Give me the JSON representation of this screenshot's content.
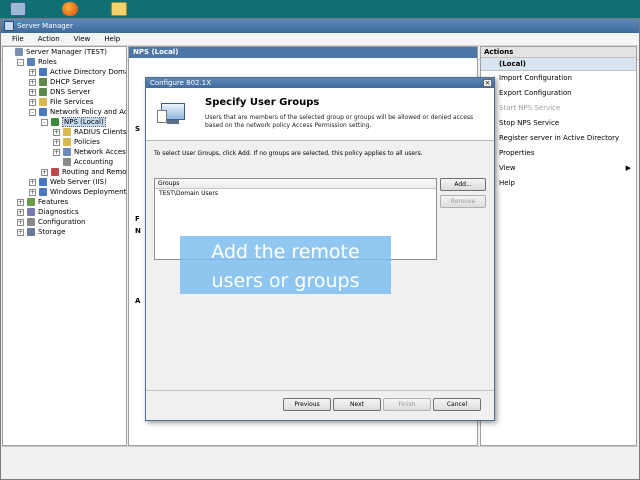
{
  "window": {
    "title": "Server Manager"
  },
  "menu": [
    "File",
    "Action",
    "View",
    "Help"
  ],
  "tree": [
    {
      "label": "Server Manager (TEST)",
      "level": 0,
      "expander": "",
      "icon": "server-icon",
      "color": "#7a8fb0"
    },
    {
      "label": "Roles",
      "level": 1,
      "expander": "-",
      "icon": "roles-icon",
      "color": "#5a7fb5"
    },
    {
      "label": "Active Directory Domain Se",
      "level": 2,
      "expander": "+",
      "icon": "directory-icon",
      "color": "#4a78c0"
    },
    {
      "label": "DHCP Server",
      "level": 2,
      "expander": "+",
      "icon": "dhcp-icon",
      "color": "#5c8a4a"
    },
    {
      "label": "DNS Server",
      "level": 2,
      "expander": "+",
      "icon": "dns-icon",
      "color": "#5c8a4a"
    },
    {
      "label": "File Services",
      "level": 2,
      "expander": "+",
      "icon": "folder-icon",
      "color": "#d8b84a"
    },
    {
      "label": "Network Policy and Access",
      "level": 2,
      "expander": "-",
      "icon": "network-icon",
      "color": "#4a78c0"
    },
    {
      "label": "NPS (Local)",
      "level": 3,
      "expander": "-",
      "icon": "nps-icon",
      "color": "#3d8a3d",
      "selected": true
    },
    {
      "label": "RADIUS Clients and",
      "level": 4,
      "expander": "+",
      "icon": "folder-icon",
      "color": "#d8b84a"
    },
    {
      "label": "Policies",
      "level": 4,
      "expander": "+",
      "icon": "folder-icon",
      "color": "#d8b84a"
    },
    {
      "label": "Network Access Pro",
      "level": 4,
      "expander": "+",
      "icon": "shield-icon",
      "color": "#6a8ac0"
    },
    {
      "label": "Accounting",
      "level": 4,
      "expander": "",
      "icon": "accounting-icon",
      "color": "#8a8a8a"
    },
    {
      "label": "Routing and Remote Ac",
      "level": 3,
      "expander": "+",
      "icon": "routing-icon",
      "color": "#c04a4a"
    },
    {
      "label": "Web Server (IIS)",
      "level": 2,
      "expander": "+",
      "icon": "web-icon",
      "color": "#4a78c0"
    },
    {
      "label": "Windows Deployment Servi",
      "level": 2,
      "expander": "+",
      "icon": "deploy-icon",
      "color": "#4a78c0"
    },
    {
      "label": "Features",
      "level": 1,
      "expander": "+",
      "icon": "features-icon",
      "color": "#6a9a4a"
    },
    {
      "label": "Diagnostics",
      "level": 1,
      "expander": "+",
      "icon": "diagnostics-icon",
      "color": "#7a7ab0"
    },
    {
      "label": "Configuration",
      "level": 1,
      "expander": "+",
      "icon": "config-icon",
      "color": "#8a8a8a"
    },
    {
      "label": "Storage",
      "level": 1,
      "expander": "+",
      "icon": "storage-icon",
      "color": "#6a7a9a"
    }
  ],
  "middle": {
    "header": "NPS (Local)",
    "stubs": [
      "S",
      "F",
      "N",
      "A"
    ]
  },
  "actions": {
    "header": "Actions",
    "section": "(Local)",
    "items": [
      {
        "label": "Import Configuration",
        "disabled": false,
        "submenu": false
      },
      {
        "label": "Export Configuration",
        "disabled": false,
        "submenu": false
      },
      {
        "label": "Start NPS Service",
        "disabled": true,
        "submenu": false
      },
      {
        "label": "Stop NPS Service",
        "disabled": false,
        "submenu": false
      },
      {
        "label": "Register server in Active Directory",
        "disabled": false,
        "submenu": false
      },
      {
        "label": "Properties",
        "disabled": false,
        "submenu": false
      },
      {
        "label": "View",
        "disabled": false,
        "submenu": true
      },
      {
        "label": "Help",
        "disabled": false,
        "submenu": false
      }
    ]
  },
  "dialog": {
    "title": "Configure 802.1X",
    "heading": "Specify User Groups",
    "description": "Users that are members of the selected group or groups will be allowed or denied access based on the network policy Access Permission setting.",
    "instruction": "To select User Groups, click Add. If no groups are selected, this policy applies to all users.",
    "groups_header": "Groups",
    "groups": [
      "TEST\\Domain Users"
    ],
    "buttons": {
      "add": "Add...",
      "remove": "Remove",
      "previous": "Previous",
      "next": "Next",
      "finish": "Finish",
      "cancel": "Cancel"
    }
  },
  "overlay": {
    "line1": "Add the remote",
    "line2": "users or groups"
  },
  "colors": {
    "taskbar": "#0f6f73",
    "title_bar": "#3d6a9c",
    "overlay": "#7dbef0"
  }
}
